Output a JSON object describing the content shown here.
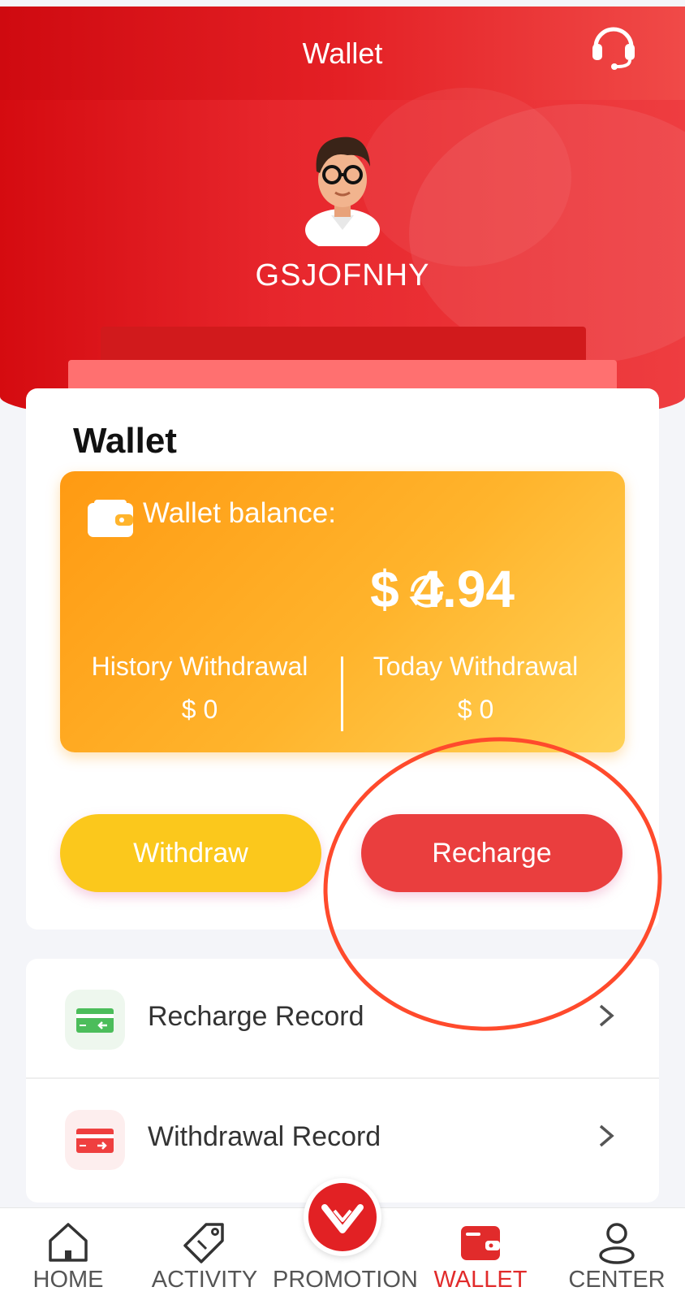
{
  "header": {
    "title": "Wallet",
    "username": "GSJOFNHY",
    "support_icon": "headset-icon",
    "avatar_icon": "user-avatar-icon"
  },
  "wallet_card": {
    "title": "Wallet",
    "balance_label": "Wallet balance:",
    "balance_amount": "$ 4.94",
    "history_withdrawal_label": "History Withdrawal",
    "history_withdrawal_value": "$ 0",
    "today_withdrawal_label": "Today Withdrawal",
    "today_withdrawal_value": "$ 0",
    "withdraw_button": "Withdraw",
    "recharge_button": "Recharge"
  },
  "records": [
    {
      "label": "Recharge Record",
      "icon": "recharge-card-icon"
    },
    {
      "label": "Withdrawal Record",
      "icon": "withdrawal-card-icon"
    }
  ],
  "tabbar": {
    "items": [
      {
        "label": "HOME",
        "icon": "home-icon"
      },
      {
        "label": "ACTIVITY",
        "icon": "tag-icon"
      },
      {
        "label": "PROMOTION",
        "icon": "promotion-icon"
      },
      {
        "label": "WALLET",
        "icon": "wallet-icon",
        "active": true
      },
      {
        "label": "CENTER",
        "icon": "user-icon"
      }
    ]
  },
  "colors": {
    "primary_red": "#e12b2b",
    "balance_orange": "#ffa41c",
    "withdraw_yellow": "#fbc81c",
    "recharge_red": "#ea3e3e",
    "annotation": "#ff4a2c"
  }
}
